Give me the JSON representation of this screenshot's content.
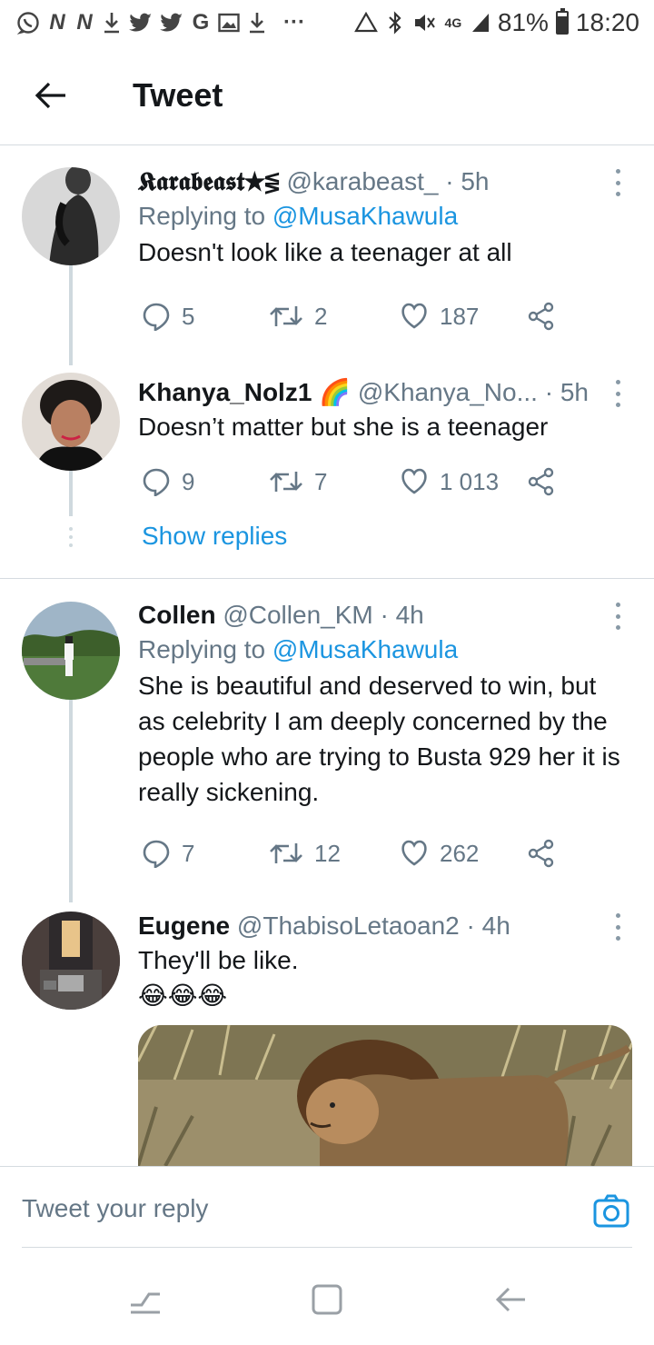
{
  "status_bar": {
    "left_icons": [
      "whatsapp-icon",
      "n-icon",
      "n-icon",
      "download-icon",
      "twitter-icon",
      "twitter-icon",
      "google-icon",
      "gallery-icon",
      "download-icon",
      "more-icon"
    ],
    "network": "4G",
    "battery_percent": "81%",
    "battery_level": 0.81,
    "time": "18:20"
  },
  "header": {
    "title": "Tweet"
  },
  "tweets": [
    {
      "name": "𝕶𝖆𝖗𝖆𝖇𝖊𝖆𝖘𝖙★⋚",
      "handle": "@karabeast_",
      "time": "· 5h",
      "reply_prefix": "Replying to",
      "reply_to": "@MusaKhawula",
      "text": "Doesn't look like a teenager at all",
      "replies": "5",
      "retweets": "2",
      "likes": "187"
    },
    {
      "name": "Khanya_Nolz1",
      "emoji": "🌈",
      "handle": "@Khanya_No...",
      "time": "· 5h",
      "text": "Doesn’t matter but she is a teenager",
      "replies": "9",
      "retweets": "7",
      "likes": "1 013"
    },
    {
      "name": "Collen",
      "handle": "@Collen_KM",
      "time": "· 4h",
      "reply_prefix": "Replying to",
      "reply_to": "@MusaKhawula",
      "text": "She is beautiful and deserved to win, but as celebrity I am deeply concerned by the people who are trying to Busta 929 her it is really sickening.",
      "replies": "7",
      "retweets": "12",
      "likes": "262"
    },
    {
      "name": "Eugene",
      "handle": "@ThabisoLetaoan2",
      "time": "· 4h",
      "text": "They'll be like.",
      "emojis": "😂😂😂"
    }
  ],
  "show_replies": "Show replies",
  "reply_bar": {
    "placeholder": "Tweet your reply"
  },
  "nav_bar": {
    "buttons": [
      "recents-icon",
      "home-icon",
      "back-icon"
    ]
  }
}
